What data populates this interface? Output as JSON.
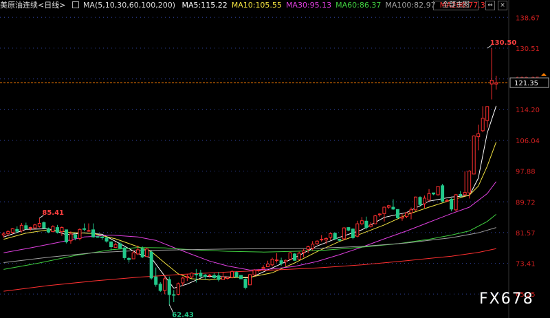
{
  "header": {
    "title": "美原油连续",
    "period": "<日线>",
    "ma_label": "MA(5,10,30,60,100,200)",
    "ma_values": [
      {
        "text": "MA5:115.22",
        "color": "#ffffff"
      },
      {
        "text": "MA10:105.55",
        "color": "#f0e040"
      },
      {
        "text": "MA30:95.13",
        "color": "#e040e0"
      },
      {
        "text": "MA60:86.37",
        "color": "#40d040"
      },
      {
        "text": "MA100:82.97",
        "color": "#a0a0a0"
      },
      {
        "text": "MA200:77.3",
        "color": "#ff3030"
      }
    ],
    "main_button": "全部主图",
    "buttons": [
      "⇔",
      "×"
    ]
  },
  "watermark": "FX678",
  "chart_data": {
    "type": "candlestick",
    "ylim": [
      62.0,
      140.0
    ],
    "y_ticks": [
      138.67,
      130.51,
      122.35,
      114.2,
      106.04,
      97.88,
      89.72,
      81.57,
      73.41,
      65.25
    ],
    "y_tick_labels": [
      "138.67",
      "130.51",
      "122.35",
      "114.20",
      "106.04",
      "97.88",
      "89.72",
      "81.57",
      "73.41",
      "65.25"
    ],
    "last_price": 121.35,
    "last_price_label": "121.35",
    "annotations": [
      {
        "label": "130.50",
        "value": 130.5,
        "index": 108
      },
      {
        "label": "85.41",
        "value": 85.41,
        "index": 8
      },
      {
        "label": "62.43",
        "value": 62.43,
        "index": 37
      }
    ],
    "colors": {
      "up": "#ff3030",
      "down": "#22c88a",
      "grid_dots": "#2a3a8a",
      "price_line": "#ff8000"
    },
    "candles": [
      [
        80.9,
        81.7,
        80.2,
        81.2
      ],
      [
        81.3,
        82.2,
        80.6,
        81.8
      ],
      [
        81.6,
        82.8,
        81.2,
        82.6
      ],
      [
        82.4,
        83.2,
        81.5,
        81.9
      ],
      [
        82.0,
        84.1,
        81.6,
        83.5
      ],
      [
        83.4,
        84.2,
        82.3,
        82.6
      ],
      [
        82.8,
        83.1,
        82.1,
        82.9
      ],
      [
        82.8,
        83.9,
        82.6,
        83.6
      ],
      [
        83.2,
        85.4,
        82.9,
        84.0
      ],
      [
        84.2,
        84.5,
        82.6,
        82.8
      ],
      [
        82.6,
        82.9,
        81.4,
        81.7
      ],
      [
        81.8,
        83.5,
        81.7,
        83.2
      ],
      [
        82.9,
        83.6,
        81.3,
        81.6
      ],
      [
        81.8,
        83.2,
        80.7,
        82.9
      ],
      [
        82.3,
        82.3,
        78.7,
        79.1
      ],
      [
        79.4,
        81.9,
        78.6,
        81.2
      ],
      [
        81.0,
        81.3,
        79.5,
        80.1
      ],
      [
        80.0,
        82.7,
        79.5,
        82.4
      ],
      [
        82.6,
        84.0,
        81.9,
        82.4
      ],
      [
        82.1,
        84.0,
        81.8,
        82.1
      ],
      [
        82.3,
        84.0,
        80.2,
        80.4
      ],
      [
        80.5,
        80.5,
        80.2,
        80.3
      ],
      [
        80.4,
        80.8,
        79.6,
        80.2
      ],
      [
        80.2,
        80.3,
        78.9,
        79.3
      ],
      [
        79.1,
        79.3,
        76.8,
        77.8
      ],
      [
        77.6,
        78.9,
        77.5,
        78.4
      ],
      [
        78.6,
        79.2,
        77.4,
        77.4
      ],
      [
        77.5,
        77.7,
        74.3,
        74.9
      ],
      [
        74.7,
        75.1,
        73.6,
        74.4
      ],
      [
        74.6,
        76.7,
        74.6,
        76.2
      ],
      [
        75.9,
        78.1,
        75.6,
        77.0
      ],
      [
        77.3,
        77.9,
        74.8,
        75.1
      ],
      [
        75.2,
        77.6,
        75.1,
        77.2
      ],
      [
        76.4,
        76.8,
        69.1,
        69.5
      ],
      [
        69.8,
        72.3,
        67.2,
        67.8
      ],
      [
        67.9,
        68.4,
        65.8,
        66.2
      ],
      [
        66.2,
        70.0,
        65.2,
        69.3
      ],
      [
        69.1,
        69.9,
        62.4,
        65.1
      ],
      [
        65.1,
        66.3,
        63.1,
        65.0
      ],
      [
        65.2,
        68.3,
        64.9,
        68.0
      ],
      [
        68.2,
        69.9,
        67.4,
        69.5
      ],
      [
        69.6,
        70.5,
        68.7,
        69.9
      ],
      [
        69.8,
        71.0,
        69.4,
        70.8
      ],
      [
        70.5,
        71.9,
        68.3,
        70.4
      ],
      [
        70.8,
        71.7,
        69.6,
        70.0
      ],
      [
        70.3,
        70.6,
        69.0,
        69.9
      ],
      [
        70.3,
        70.6,
        69.6,
        70.3
      ],
      [
        70.2,
        70.8,
        69.3,
        69.6
      ],
      [
        70.1,
        71.1,
        68.6,
        69.1
      ],
      [
        69.1,
        71.1,
        69.0,
        69.8
      ],
      [
        69.4,
        69.9,
        69.1,
        69.7
      ],
      [
        69.7,
        71.6,
        69.4,
        71.2
      ],
      [
        71.0,
        71.3,
        69.6,
        69.8
      ],
      [
        70.2,
        70.3,
        69.2,
        69.3
      ],
      [
        69.2,
        69.4,
        66.5,
        67.0
      ],
      [
        67.7,
        70.6,
        67.6,
        70.4
      ],
      [
        70.3,
        71.9,
        70.0,
        71.6
      ],
      [
        71.4,
        71.9,
        71.0,
        71.6
      ],
      [
        72.0,
        72.9,
        71.7,
        72.3
      ],
      [
        72.5,
        74.1,
        72.4,
        73.2
      ],
      [
        73.0,
        74.9,
        72.6,
        74.5
      ],
      [
        74.2,
        76.1,
        73.6,
        74.3
      ],
      [
        74.1,
        74.9,
        72.8,
        73.4
      ],
      [
        73.8,
        74.4,
        72.7,
        74.2
      ],
      [
        74.5,
        76.4,
        74.2,
        76.2
      ],
      [
        75.9,
        76.1,
        74.1,
        74.2
      ],
      [
        74.5,
        76.5,
        74.3,
        76.1
      ],
      [
        76.3,
        77.2,
        75.0,
        76.7
      ],
      [
        77.1,
        78.1,
        76.1,
        77.8
      ],
      [
        77.4,
        79.3,
        76.8,
        78.5
      ],
      [
        78.6,
        79.5,
        78.3,
        79.3
      ],
      [
        79.6,
        80.9,
        79.2,
        79.8
      ],
      [
        79.6,
        80.3,
        78.5,
        80.0
      ],
      [
        80.3,
        81.6,
        79.6,
        81.3
      ],
      [
        81.4,
        81.6,
        79.6,
        79.9
      ],
      [
        79.8,
        79.9,
        79.3,
        79.5
      ],
      [
        79.9,
        83.0,
        79.5,
        82.8
      ],
      [
        82.9,
        83.0,
        81.9,
        82.2
      ],
      [
        82.5,
        82.7,
        79.8,
        80.2
      ],
      [
        80.6,
        84.7,
        80.3,
        83.9
      ],
      [
        83.9,
        85.7,
        83.5,
        84.7
      ],
      [
        84.6,
        85.8,
        82.4,
        82.9
      ],
      [
        83.2,
        84.3,
        82.9,
        83.6
      ],
      [
        83.9,
        86.3,
        83.8,
        86.0
      ],
      [
        86.3,
        86.7,
        85.8,
        86.5
      ],
      [
        86.6,
        88.5,
        84.5,
        88.3
      ],
      [
        88.3,
        88.9,
        87.9,
        88.7
      ],
      [
        88.3,
        90.4,
        87.6,
        87.8
      ],
      [
        87.7,
        87.7,
        85.2,
        85.5
      ],
      [
        85.4,
        86.5,
        84.7,
        85.7
      ],
      [
        85.8,
        87.0,
        85.4,
        86.8
      ],
      [
        86.8,
        88.2,
        85.1,
        87.6
      ],
      [
        87.6,
        91.1,
        87.4,
        91.0
      ],
      [
        90.9,
        91.2,
        88.4,
        89.0
      ],
      [
        89.2,
        91.4,
        88.1,
        90.7
      ],
      [
        90.2,
        93.1,
        89.8,
        91.9
      ],
      [
        92.1,
        92.1,
        91.5,
        91.8
      ],
      [
        91.6,
        93.9,
        91.4,
        93.8
      ],
      [
        94.0,
        94.5,
        89.6,
        89.9
      ],
      [
        89.9,
        90.5,
        89.8,
        90.1
      ],
      [
        90.4,
        90.7,
        87.2,
        87.8
      ],
      [
        87.6,
        91.8,
        87.2,
        91.6
      ],
      [
        91.7,
        92.6,
        90.9,
        91.4
      ],
      [
        91.6,
        97.8,
        91.3,
        92.2
      ],
      [
        92.1,
        98.1,
        90.6,
        97.9
      ],
      [
        97.1,
        107.4,
        97.0,
        107.2
      ],
      [
        107.0,
        110.2,
        103.4,
        107.8
      ],
      [
        108.6,
        115.1,
        108.2,
        111.9
      ],
      [
        111.3,
        114.9,
        109.4,
        115.0
      ],
      [
        121.0,
        130.5,
        116.9,
        122.0
      ],
      [
        121.0,
        123.2,
        119.5,
        121.35
      ]
    ],
    "ma_lines": [
      {
        "name": "MA5",
        "color": "#ffffff",
        "points": [
          [
            0,
            80.4
          ],
          [
            5,
            82.4
          ],
          [
            10,
            82.6
          ],
          [
            14,
            81.0
          ],
          [
            18,
            81.5
          ],
          [
            22,
            81.1
          ],
          [
            26,
            78.6
          ],
          [
            30,
            76.0
          ],
          [
            33,
            74.8
          ],
          [
            36,
            70.0
          ],
          [
            38,
            66.8
          ],
          [
            41,
            67.9
          ],
          [
            45,
            70.0
          ],
          [
            50,
            69.8
          ],
          [
            55,
            69.5
          ],
          [
            60,
            72.2
          ],
          [
            65,
            74.9
          ],
          [
            70,
            78.0
          ],
          [
            75,
            80.3
          ],
          [
            80,
            82.3
          ],
          [
            85,
            85.6
          ],
          [
            90,
            86.9
          ],
          [
            95,
            89.9
          ],
          [
            100,
            91.0
          ],
          [
            104,
            91.4
          ],
          [
            106,
            96.0
          ],
          [
            108,
            108.0
          ],
          [
            110,
            115.2
          ]
        ]
      },
      {
        "name": "MA10",
        "color": "#f0e040",
        "points": [
          [
            0,
            79.8
          ],
          [
            5,
            81.4
          ],
          [
            10,
            82.3
          ],
          [
            15,
            81.6
          ],
          [
            20,
            81.3
          ],
          [
            25,
            79.9
          ],
          [
            30,
            77.8
          ],
          [
            33,
            76.5
          ],
          [
            36,
            73.5
          ],
          [
            39,
            70.6
          ],
          [
            42,
            69.3
          ],
          [
            46,
            69.0
          ],
          [
            50,
            69.6
          ],
          [
            55,
            69.7
          ],
          [
            60,
            70.9
          ],
          [
            65,
            73.5
          ],
          [
            70,
            76.5
          ],
          [
            75,
            79.2
          ],
          [
            80,
            81.3
          ],
          [
            85,
            83.6
          ],
          [
            90,
            86.3
          ],
          [
            95,
            88.3
          ],
          [
            100,
            90.2
          ],
          [
            104,
            91.5
          ],
          [
            106,
            93.9
          ],
          [
            108,
            99.2
          ],
          [
            110,
            105.6
          ]
        ]
      },
      {
        "name": "MA30",
        "color": "#e040e0",
        "points": [
          [
            0,
            76.2
          ],
          [
            6,
            77.5
          ],
          [
            12,
            78.9
          ],
          [
            18,
            80.4
          ],
          [
            24,
            80.9
          ],
          [
            30,
            80.4
          ],
          [
            34,
            79.5
          ],
          [
            38,
            77.6
          ],
          [
            42,
            75.8
          ],
          [
            46,
            74.0
          ],
          [
            50,
            72.7
          ],
          [
            55,
            71.6
          ],
          [
            60,
            71.9
          ],
          [
            65,
            72.6
          ],
          [
            70,
            73.9
          ],
          [
            75,
            75.7
          ],
          [
            80,
            77.7
          ],
          [
            85,
            79.9
          ],
          [
            90,
            82.0
          ],
          [
            95,
            84.3
          ],
          [
            100,
            86.6
          ],
          [
            104,
            88.3
          ],
          [
            108,
            91.9
          ],
          [
            110,
            95.1
          ]
        ]
      },
      {
        "name": "MA60",
        "color": "#40d040",
        "points": [
          [
            0,
            71.8
          ],
          [
            8,
            73.5
          ],
          [
            16,
            75.5
          ],
          [
            24,
            77.0
          ],
          [
            30,
            77.6
          ],
          [
            36,
            77.5
          ],
          [
            42,
            77.0
          ],
          [
            50,
            76.6
          ],
          [
            58,
            76.4
          ],
          [
            65,
            76.6
          ],
          [
            72,
            76.9
          ],
          [
            80,
            77.7
          ],
          [
            88,
            78.6
          ],
          [
            95,
            79.8
          ],
          [
            100,
            80.9
          ],
          [
            104,
            82.0
          ],
          [
            108,
            84.5
          ],
          [
            110,
            86.4
          ]
        ]
      },
      {
        "name": "MA100",
        "color": "#a0a0a0",
        "points": [
          [
            0,
            73.6
          ],
          [
            10,
            75.0
          ],
          [
            20,
            76.2
          ],
          [
            30,
            76.8
          ],
          [
            40,
            77.0
          ],
          [
            50,
            77.2
          ],
          [
            60,
            77.3
          ],
          [
            70,
            77.4
          ],
          [
            80,
            77.9
          ],
          [
            90,
            78.8
          ],
          [
            100,
            80.2
          ],
          [
            106,
            81.5
          ],
          [
            110,
            82.9
          ]
        ]
      },
      {
        "name": "MA200",
        "color": "#ff3030",
        "points": [
          [
            0,
            66.0
          ],
          [
            10,
            67.5
          ],
          [
            20,
            68.7
          ],
          [
            30,
            69.7
          ],
          [
            40,
            70.5
          ],
          [
            50,
            71.1
          ],
          [
            60,
            71.6
          ],
          [
            70,
            72.2
          ],
          [
            80,
            73.0
          ],
          [
            90,
            74.1
          ],
          [
            100,
            75.3
          ],
          [
            106,
            76.3
          ],
          [
            110,
            77.3
          ]
        ]
      }
    ]
  }
}
